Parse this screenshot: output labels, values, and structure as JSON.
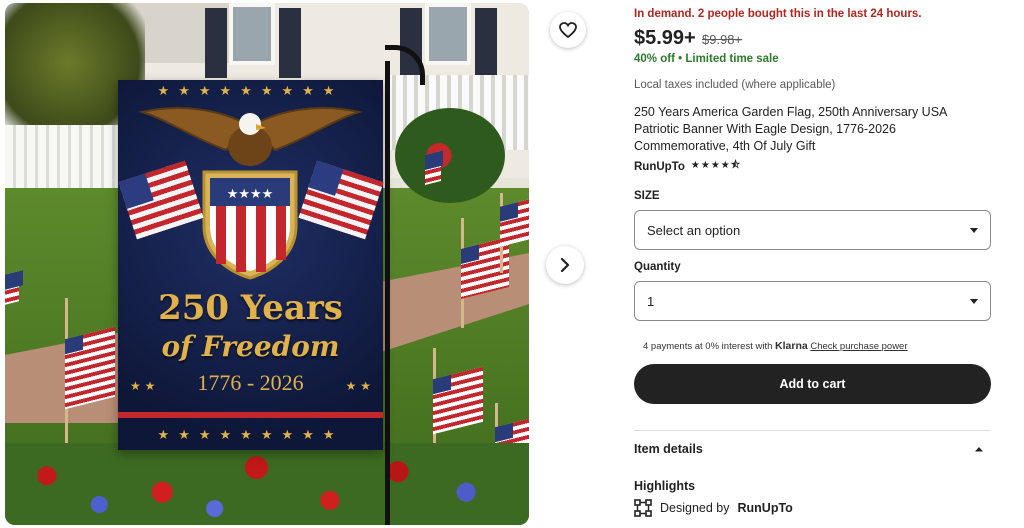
{
  "listing_image": {
    "flag_title_line1": "250 Years",
    "flag_title_line2": "of Freedom",
    "flag_years": "1776 - 2026"
  },
  "product": {
    "demand_notice": "In demand. 2 people bought this in the last 24 hours.",
    "price": "$5.99+",
    "original_price": "$9.98+",
    "discount": "40% off",
    "sale_note": "Limited time sale",
    "taxes_note": "Local taxes included (where applicable)",
    "title": "250 Years America Garden Flag, 250th Anniversary USA Patriotic Banner With Eagle Design, 1776-2026 Commemorative, 4th Of July Gift",
    "shop_name": "RunUpTo",
    "rating_stars": "★★★★⯪"
  },
  "options": {
    "size_label": "SIZE",
    "size_value": "Select an option",
    "quantity_label": "Quantity",
    "quantity_value": "1"
  },
  "payment": {
    "klarna_text": "4 payments at 0% interest with",
    "klarna_brand": "Klarna",
    "klarna_link": "Check purchase power"
  },
  "actions": {
    "add_to_cart": "Add to cart"
  },
  "sections": {
    "item_details": "Item details",
    "highlights": "Highlights",
    "designed_by": "Designed by",
    "designer": "RunUpTo"
  },
  "colors": {
    "demand": "#b3261e",
    "sale": "#2d7a2d",
    "button": "#222222",
    "flag_gold": "#e2b24a",
    "flag_navy": "#0e1738"
  },
  "icons": {
    "favorite": "heart-icon",
    "next": "chevron-right-icon",
    "collapse": "chevron-up-icon",
    "designed": "design-tool-icon"
  }
}
